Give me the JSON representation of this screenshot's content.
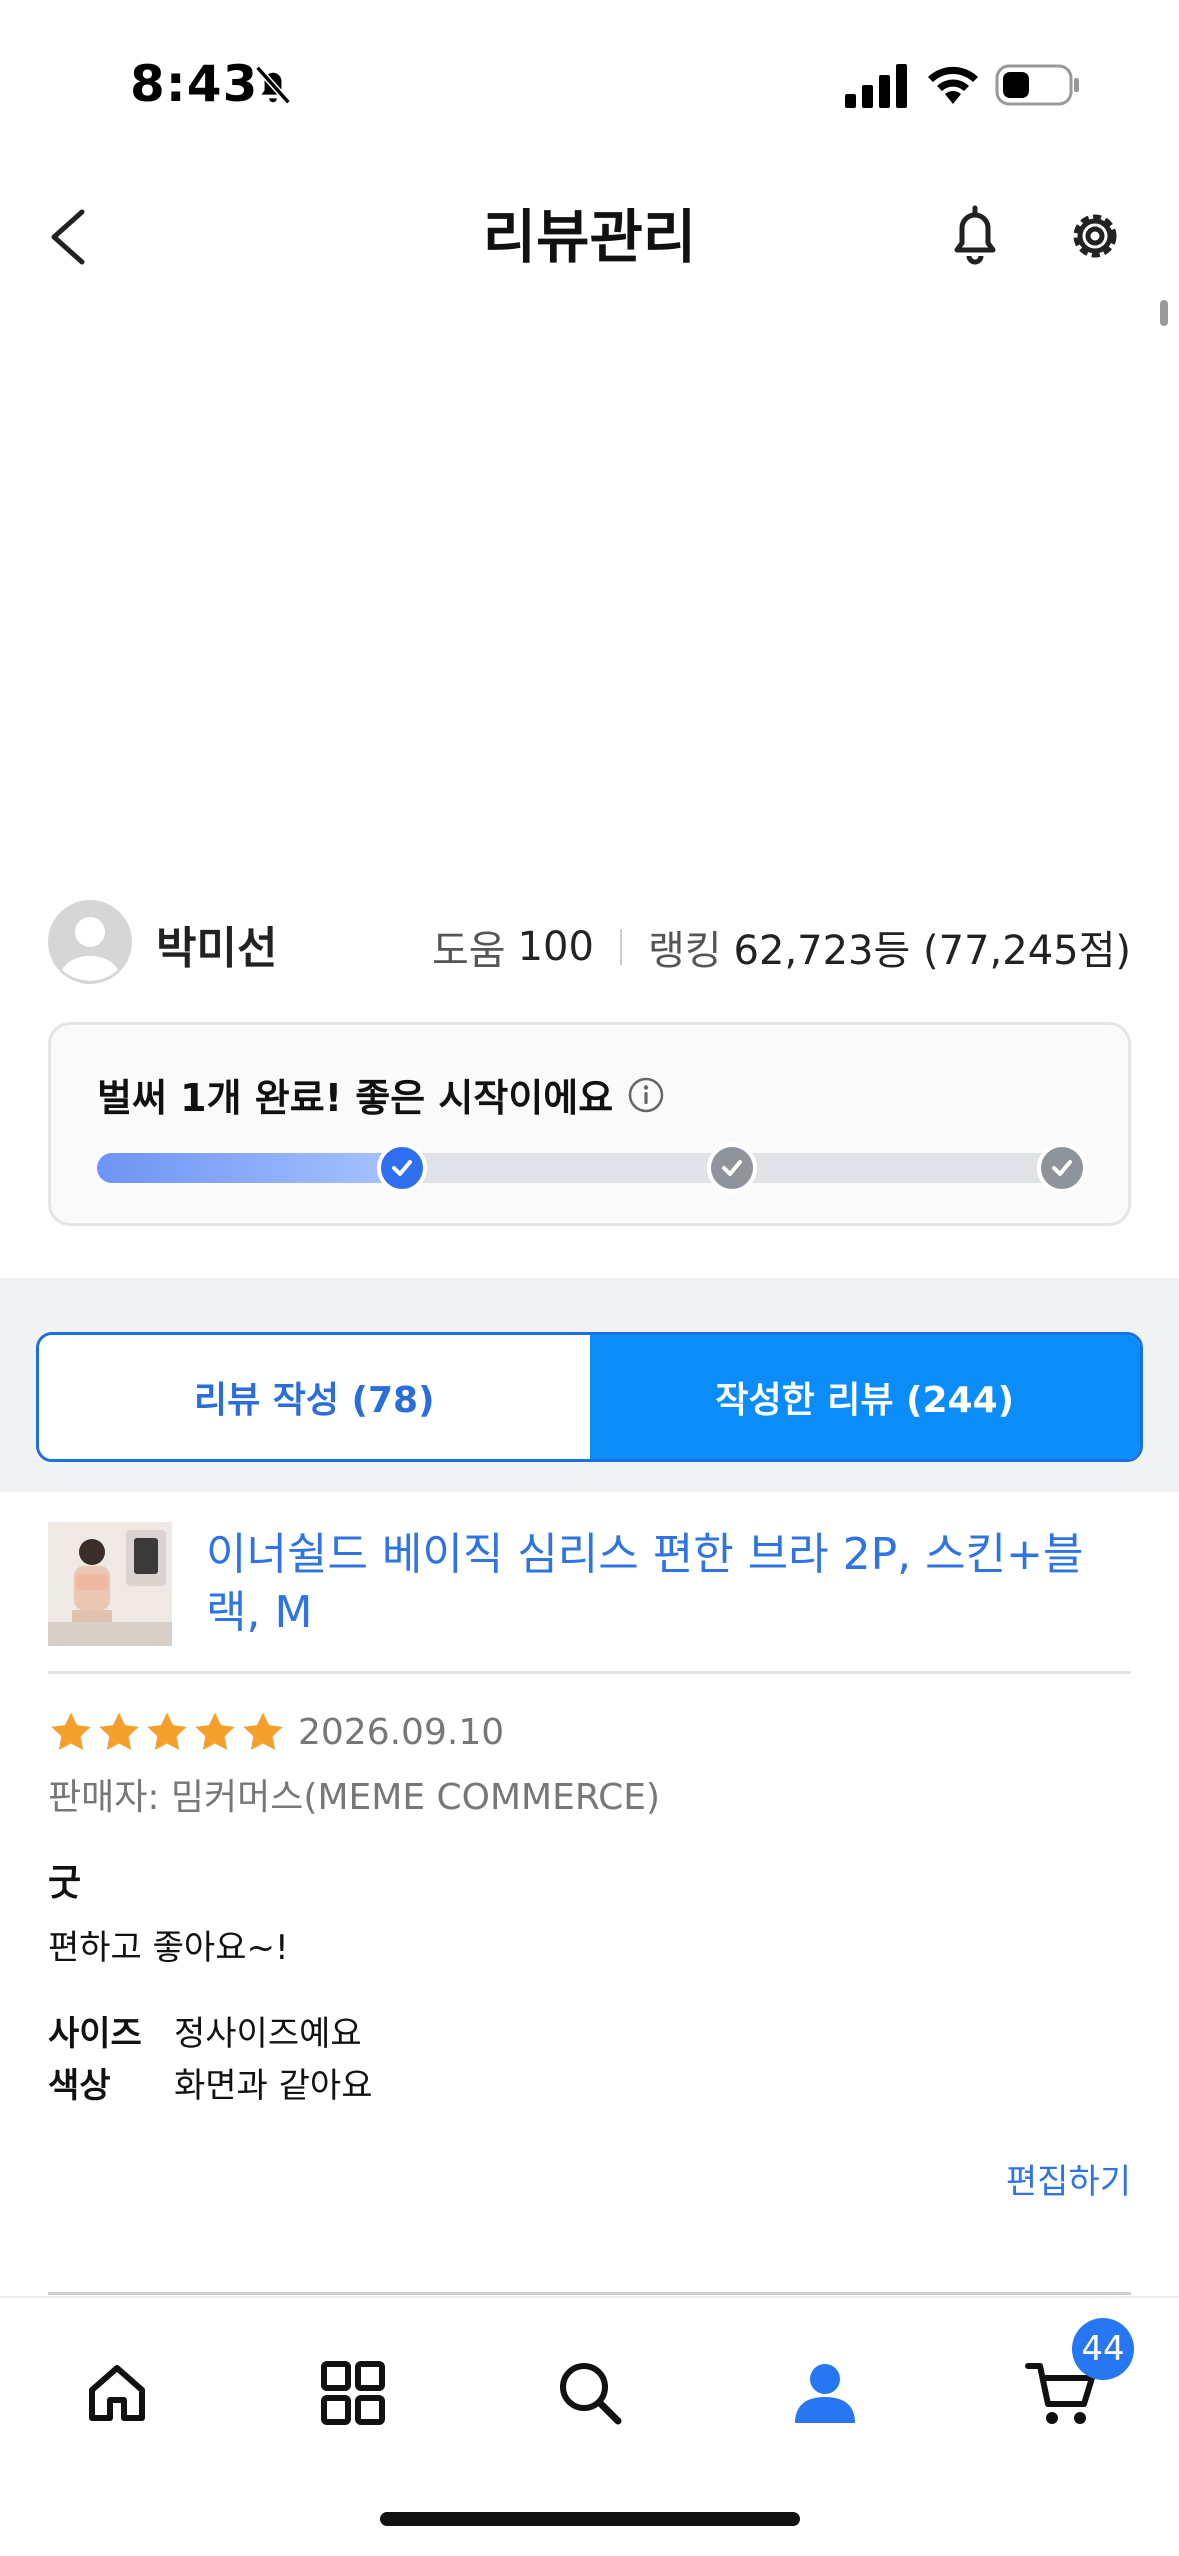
{
  "status_bar": {
    "time": "8:43",
    "icons": [
      "bell-slash-icon",
      "signal-icon",
      "wifi-icon",
      "battery-icon"
    ]
  },
  "header": {
    "title": "리뷰관리",
    "icons": [
      "back-icon",
      "bell-icon",
      "gear-icon"
    ]
  },
  "profile": {
    "name": "박미선",
    "help_label": "도움",
    "help_value": "100",
    "ranking_label": "랭킹",
    "ranking_value": "62,723등 (77,245점)"
  },
  "progress": {
    "message": "벌써 1개 완료! 좋은 시작이에요",
    "steps_total": 3,
    "steps_completed": 1
  },
  "tabs": {
    "write_label": "리뷰 작성 (78)",
    "written_label": "작성한 리뷰 (244)",
    "active": "written"
  },
  "review": {
    "product_name": "이너쉴드 베이직 심리스 편한 브라 2P, 스킨+블랙, M",
    "rating": 5,
    "date": "2026.09.10",
    "seller": "판매자: 밈커머스(MEME COMMERCE)",
    "title": "굿",
    "body": "편하고 좋아요~!",
    "attributes": [
      {
        "key": "사이즈",
        "value": "정사이즈예요"
      },
      {
        "key": "색상",
        "value": "화면과 같아요"
      }
    ],
    "edit_label": "편집하기"
  },
  "bottom_nav": {
    "items": [
      "home-icon",
      "category-icon",
      "search-icon",
      "my-page-icon",
      "cart-icon"
    ],
    "active": "my-page-icon",
    "cart_count": "44"
  },
  "colors": {
    "accent_blue": "#0a8cf9",
    "link_blue": "#2e74e3",
    "star_orange": "#f5a02d",
    "progress_blue": "#2f6ff0"
  }
}
